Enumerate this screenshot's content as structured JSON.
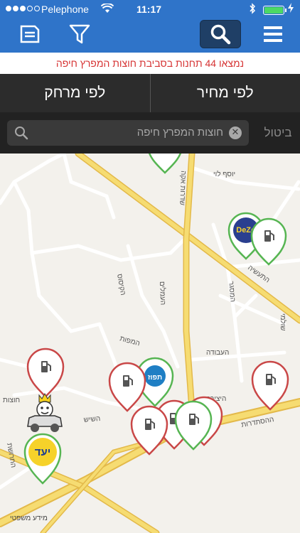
{
  "status_bar": {
    "carrier": "Pelephone",
    "time": "11:17",
    "wifi_icon": "wifi-icon",
    "bluetooth_icon": "bluetooth-icon",
    "battery_level": 1.0,
    "charging_icon": "charging-icon",
    "signal_bars_filled": 3,
    "signal_bars_total": 5
  },
  "nav_bar": {
    "list_icon": "list-icon",
    "filter_icon": "filter-icon",
    "search_icon": "search-icon",
    "menu_icon": "hamburger-menu-icon"
  },
  "results_message": "נמצאו 44 תחנות בסביבת חוצות המפרץ חיפה",
  "sort_tabs": {
    "by_distance": "לפי מרחק",
    "by_price": "לפי מחיר",
    "selected": "by_price"
  },
  "search": {
    "value": "חוצות המפרץ חיפה",
    "cancel_label": "ביטול"
  },
  "map": {
    "credit": "מידע משפטי",
    "street_labels": [
      "יוסף לוי",
      "יוסף לוי",
      "התעשיה",
      "הקיסוס",
      "העמלים",
      "המפות",
      "העבודה",
      "המסגר",
      "ההסתדרות",
      "היצירה",
      "השיש",
      "חוצות",
      "החרושת",
      "שולמי",
      "שדרות אקה",
      "ההסתדרות"
    ],
    "brand_logos": [
      "Dor Alon",
      "Tapuz",
      "Yellow/Paz"
    ],
    "colors": {
      "pin_red": "#c94747",
      "pin_green": "#56b552",
      "road_yellow": "#f2d15c",
      "road_white": "#ffffff",
      "map_bg": "#f3f1ec"
    }
  },
  "brand_logo_labels": {
    "dor_alon": "DeZo",
    "paz": "יעד",
    "tapuz": "תפוז"
  }
}
